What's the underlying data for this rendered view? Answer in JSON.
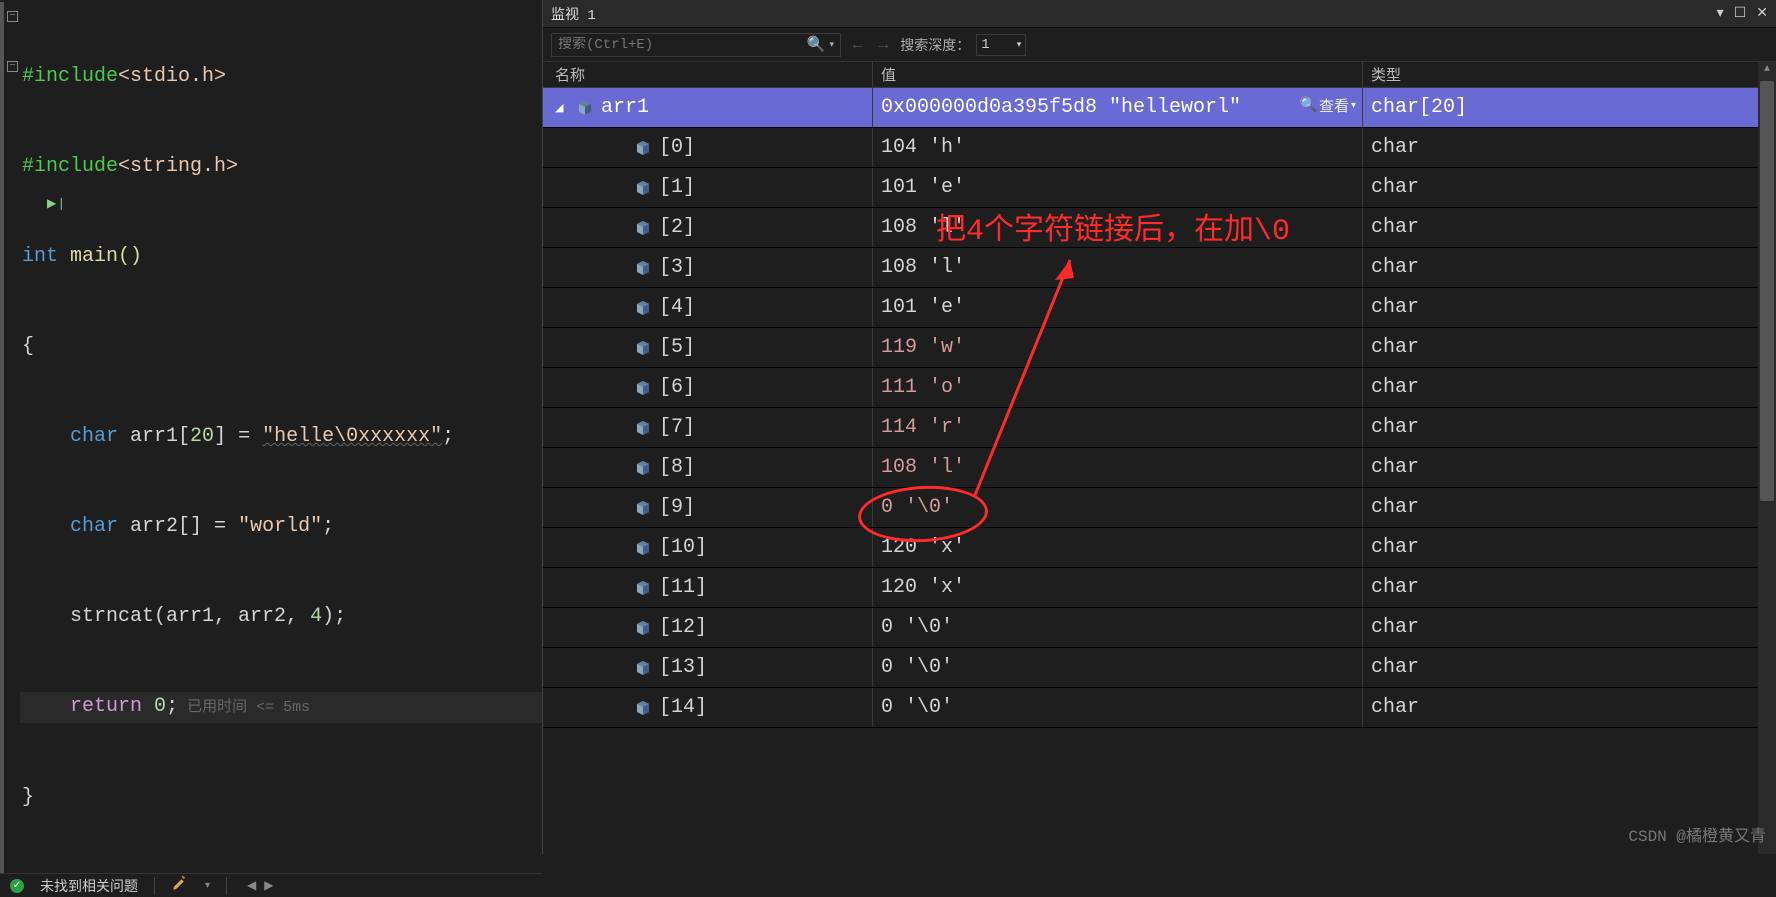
{
  "code": {
    "line1": "#include",
    "line1_b": "<stdio.h>",
    "line2": "#include",
    "line2_b": "<string.h>",
    "line3_a": "int",
    "line3_b": " main()",
    "line4": "{",
    "line5_a": "char",
    "line5_b": " arr1[",
    "line5_c": "20",
    "line5_d": "] = ",
    "line5_e": "\"helle\\0xxxxxx\"",
    "line5_f": ";",
    "line6_a": "char",
    "line6_b": " arr2[] = ",
    "line6_c": "\"world\"",
    "line6_d": ";",
    "line7_a": "strncat(arr1, arr2, ",
    "line7_b": "4",
    "line7_c": ");",
    "line8_a": "return",
    "line8_b": " ",
    "line8_c": "0",
    "line8_d": ";",
    "line8_hint": " 已用时间 <= 5ms",
    "line9": "}"
  },
  "status": {
    "ok_text": "未找到相关问题"
  },
  "watch": {
    "panel_title": "监视 1",
    "search_placeholder": "搜索(Ctrl+E)",
    "depth_label": "搜索深度：",
    "depth_value": "1",
    "headers": {
      "name": "名称",
      "value": "值",
      "type": "类型"
    },
    "root": {
      "name": "arr1",
      "value": "0x000000d0a395f5d8 \"helleworl\"",
      "view_label": "查看",
      "type": "char[20]"
    },
    "children": [
      {
        "name": "[0]",
        "value": "104 'h'",
        "type": "char",
        "changed": false
      },
      {
        "name": "[1]",
        "value": "101 'e'",
        "type": "char",
        "changed": false
      },
      {
        "name": "[2]",
        "value": "108 'l'",
        "type": "char",
        "changed": false
      },
      {
        "name": "[3]",
        "value": "108 'l'",
        "type": "char",
        "changed": false
      },
      {
        "name": "[4]",
        "value": "101 'e'",
        "type": "char",
        "changed": false
      },
      {
        "name": "[5]",
        "value": "119 'w'",
        "type": "char",
        "changed": true
      },
      {
        "name": "[6]",
        "value": "111 'o'",
        "type": "char",
        "changed": true
      },
      {
        "name": "[7]",
        "value": "114 'r'",
        "type": "char",
        "changed": true
      },
      {
        "name": "[8]",
        "value": "108 'l'",
        "type": "char",
        "changed": true
      },
      {
        "name": "[9]",
        "value": "0 '\\0'",
        "type": "char",
        "changed": true
      },
      {
        "name": "[10]",
        "value": "120 'x'",
        "type": "char",
        "changed": false
      },
      {
        "name": "[11]",
        "value": "120 'x'",
        "type": "char",
        "changed": false
      },
      {
        "name": "[12]",
        "value": "0 '\\0'",
        "type": "char",
        "changed": false
      },
      {
        "name": "[13]",
        "value": "0 '\\0'",
        "type": "char",
        "changed": false
      },
      {
        "name": "[14]",
        "value": "0 '\\0'",
        "type": "char",
        "changed": false
      }
    ]
  },
  "annotation": {
    "text": "把4个字符链接后，在加\\0"
  },
  "watermark": "CSDN @橘橙黄又青"
}
